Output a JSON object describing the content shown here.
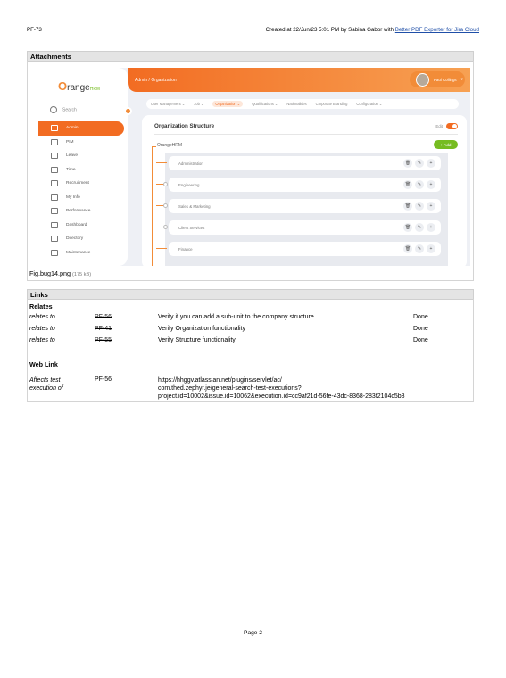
{
  "header": {
    "key": "PF-73",
    "created_prefix": "Created at 22/Jun/23 5:01 PM by Sabina Gabor with ",
    "exporter_link": "Better PDF Exporter for Jira Cloud"
  },
  "attachments": {
    "title": "Attachments",
    "caption_name": "Fig.bug14.png",
    "caption_size": "(175 kB)",
    "screenshot": {
      "logo_text": "range",
      "logo_o": "O",
      "logo_suffix": "HRM",
      "search_label": "Search",
      "nav": [
        "Admin",
        "PIM",
        "Leave",
        "Time",
        "Recruitment",
        "My Info",
        "Performance",
        "Dashboard",
        "Directory",
        "Maintenance"
      ],
      "breadcrumb": "Admin / Organization",
      "user_name": "Paul Collings",
      "tabs": [
        "User Management ⌄",
        "Job ⌄",
        "Organization ⌄",
        "Qualifications ⌄",
        "Nationalities",
        "Corporate Branding",
        "Configuration ⌄"
      ],
      "card_title": "Organization Structure",
      "edit_label": "Edit",
      "root_unit": "OrangeHRM",
      "add_label": "+ Add",
      "units": [
        "Administration",
        "Engineering",
        "Sales & Marketing",
        "Client Services",
        "Finance"
      ]
    }
  },
  "links": {
    "title": "Links",
    "relates_title": "Relates",
    "relates": [
      {
        "type": "relates to",
        "key": "PF-56",
        "summary": "Verify if you can add a sub-unit to the company structure",
        "status": "Done"
      },
      {
        "type": "relates to",
        "key": "PF-41",
        "summary": "Verify Organization functionality",
        "status": "Done"
      },
      {
        "type": "relates to",
        "key": "PF-55",
        "summary": "Verify Structure functionality",
        "status": "Done"
      }
    ],
    "web_title": "Web Link",
    "web": {
      "type": "Affects test execution of",
      "key": "PF-56",
      "url_l1": "https://hhggv.atlassian.net/plugins/servlet/ac/",
      "url_l2": "com.thed.zephyr.je/general-search-test-executions?",
      "url_l3": "project.id=10002&issue.id=10062&execution.id=cc9af21d-56fe-43dc-8368-283f2104c5b8"
    }
  },
  "footer": {
    "page": "Page 2"
  }
}
